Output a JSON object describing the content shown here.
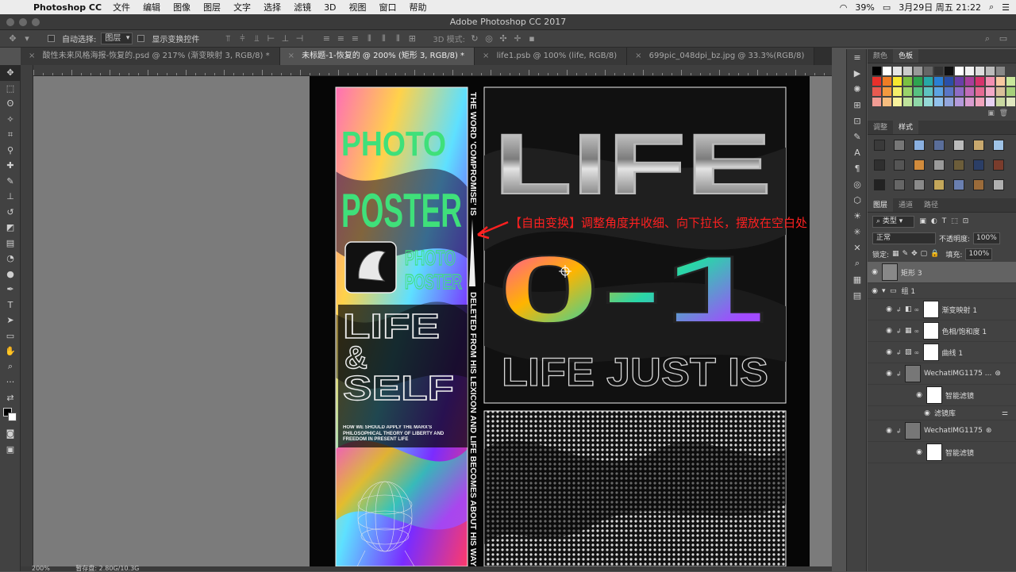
{
  "macbar": {
    "app": "Photoshop CC",
    "menus": [
      "文件",
      "编辑",
      "图像",
      "图层",
      "文字",
      "选择",
      "滤镜",
      "3D",
      "视图",
      "窗口",
      "帮助"
    ],
    "battery": "39%",
    "datetime": "3月29日 周五  21:22"
  },
  "window": {
    "title": "Adobe Photoshop CC 2017"
  },
  "options": {
    "auto_select": "自动选择:",
    "layer_select": "图层",
    "show_transform": "显示变换控件",
    "mode_3d": "3D 模式:"
  },
  "tabs": [
    {
      "label": "酸性未来风格海报-恢复的.psd @ 217% (渐变映射 3, RGB/8) *"
    },
    {
      "label": "未标题-1-恢复的 @ 200% (矩形 3, RGB/8) *"
    },
    {
      "label": "life1.psb @ 100% (life, RGB/8)"
    },
    {
      "label": "699pic_048dpi_bz.jpg @ 33.3%(RGB/8)"
    }
  ],
  "status": {
    "zoom": "200%",
    "doc": "暂存盘: 2.80G/10.3G"
  },
  "panel_color": {
    "tabs": [
      "颜色",
      "色板"
    ]
  },
  "panel_styles": {
    "tabs": [
      "调整",
      "样式"
    ]
  },
  "panel_layers": {
    "tabs": [
      "图层",
      "通道",
      "路径"
    ],
    "filter_kind": "类型",
    "blend_mode": "正常",
    "opacity_label": "不透明度:",
    "opacity": "100%",
    "lock_label": "锁定:",
    "fill_label": "填充:",
    "fill": "100%",
    "layers": [
      {
        "name": "矩形 3"
      },
      {
        "name": "组 1"
      },
      {
        "name": "渐变映射 1"
      },
      {
        "name": "色相/饱和度 1"
      },
      {
        "name": "曲线 1"
      },
      {
        "name": "WechatIMG1175 ..."
      },
      {
        "name": "智能滤镜"
      },
      {
        "name": "滤镜库"
      },
      {
        "name": "WechatIMG1175"
      },
      {
        "name": "智能滤镜"
      }
    ]
  },
  "poster": {
    "title_line1": "PHOTO",
    "title_line2": "POSTER",
    "small_line1": "PHOTO",
    "small_line2": "POSTER",
    "life": "LIFE",
    "amp": "&",
    "self": "SELF",
    "fine_print": "HOW WE SHOULD APPLY THE MARX'S PHILOSOPHICAL THEORY OF LIBERTY AND FREEDOM IN PRESENT LIFE",
    "vertical_text_top": "THE WORD 'COMPROMISE' IS",
    "vertical_text_bottom": "DELETED FROM HIS LEXICON AND LIFE BECOMES ABOUT HIS WAY",
    "big_life": "LIFE",
    "big_number": "0-1",
    "tagline": "LIFE JUST IS"
  },
  "annotation": {
    "text": "【自由变换】调整角度并收细、向下拉长，摆放在空白处"
  },
  "colors": {
    "accent_green": "#3fe07a",
    "annotation_red": "#ff2020"
  }
}
